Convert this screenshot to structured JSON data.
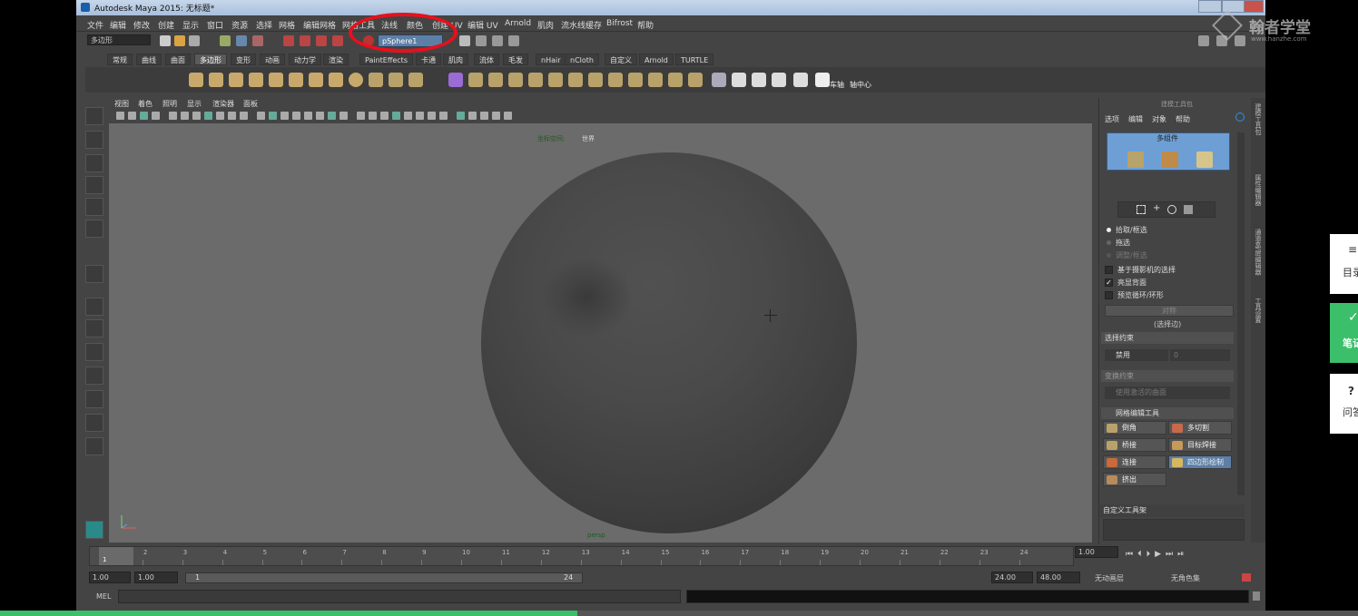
{
  "window": {
    "title": "Autodesk Maya 2015: 无标题*"
  },
  "menubar": [
    "文件",
    "编辑",
    "修改",
    "创建",
    "显示",
    "窗口",
    "资源",
    "选择",
    "网格",
    "编辑网格",
    "网格工具",
    "法线",
    "颜色",
    "创建 UV",
    "编辑 UV",
    "Arnold",
    "肌肉",
    "流水线缓存",
    "Bifrost",
    "帮助"
  ],
  "status": {
    "mode": "多边形",
    "object_field": "pSphere1"
  },
  "shelf_tabs": [
    "常规",
    "曲线",
    "曲面",
    "多边形",
    "变形",
    "动画",
    "动力学",
    "渲染",
    "PaintEffects",
    "卡通",
    "肌肉",
    "流体",
    "毛发",
    "nHair",
    "nCloth",
    "自定义",
    "Arnold",
    "TURTLE"
  ],
  "shelf_active": "多边形",
  "shelf_labels": [
    "车轴",
    "轴中心"
  ],
  "viewport": {
    "menu": [
      "视图",
      "着色",
      "照明",
      "显示",
      "渲染器",
      "面板"
    ],
    "coord_label": "坐标空间:",
    "coord_value": "世界",
    "camera": "persp"
  },
  "modeling_toolkit": {
    "title": "建模工具包",
    "menu": [
      "选项",
      "编辑",
      "对象",
      "帮助"
    ],
    "component_label": "多组件",
    "pick_options": [
      "拾取/框选",
      "拖选",
      "调整/框选"
    ],
    "checkboxes": [
      {
        "label": "基于摄影机的选择",
        "checked": false
      },
      {
        "label": "亮显背面",
        "checked": true
      },
      {
        "label": "预览循环/环形",
        "checked": false
      }
    ],
    "symmetry_button": "对称",
    "symmetry_sub": "(选择边)",
    "select_constraint": "选择约束",
    "constraint_value": "禁用",
    "constraint_number": "0",
    "transform_constraint": "变换约束",
    "transform_value": "使用激活的曲面",
    "mesh_tools_title": "网格编辑工具",
    "mesh_tools": [
      {
        "label": "倒角",
        "active": false
      },
      {
        "label": "多切割",
        "active": false
      },
      {
        "label": "桥接",
        "active": false
      },
      {
        "label": "目标焊接",
        "active": false
      },
      {
        "label": "连接",
        "active": false
      },
      {
        "label": "四边形绘制",
        "active": true
      },
      {
        "label": "挤出",
        "active": false
      }
    ],
    "custom_shelf": "自定义工具架"
  },
  "right_strip": [
    "建模工具包",
    "属性编辑器",
    "通道盒/层编辑器",
    "工具设置"
  ],
  "timeline": {
    "ticks": [
      "1",
      "2",
      "3",
      "4",
      "5",
      "6",
      "7",
      "8",
      "9",
      "10",
      "11",
      "12",
      "13",
      "14",
      "15",
      "16",
      "17",
      "18",
      "19",
      "20",
      "21",
      "22",
      "23",
      "24"
    ],
    "current_frame": "1.00",
    "playhead": "1"
  },
  "range": {
    "start": "1.00",
    "start2": "1.00",
    "range_start": "1",
    "range_end": "24",
    "end": "24.00",
    "end2": "48.00",
    "anim_layer": "无动画层",
    "char_set": "无角色集"
  },
  "cmdline": {
    "label": "MEL"
  },
  "watermark": {
    "text": "翰者学堂",
    "url": "www.hanzhe.com"
  },
  "side_cards": [
    {
      "icon": "≡",
      "label": "目录"
    },
    {
      "icon": "✓",
      "label": "笔记"
    },
    {
      "icon": "?",
      "label": "问答"
    }
  ],
  "progress": {
    "fraction": 0.425
  }
}
